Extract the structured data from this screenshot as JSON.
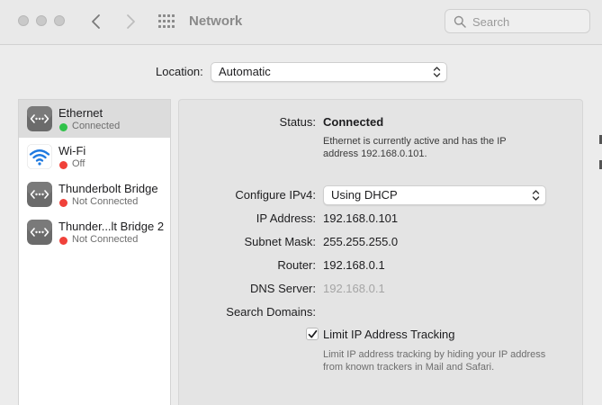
{
  "window": {
    "title": "Network"
  },
  "search": {
    "placeholder": "Search"
  },
  "location": {
    "label": "Location:",
    "value": "Automatic"
  },
  "sidebar": {
    "items": [
      {
        "name": "Ethernet",
        "status": "Connected",
        "status_color": "#30c24a",
        "icon": "ethernet-icon",
        "selected": true
      },
      {
        "name": "Wi-Fi",
        "status": "Off",
        "status_color": "#f0413a",
        "icon": "wifi-icon",
        "selected": false
      },
      {
        "name": "Thunderbolt Bridge",
        "status": "Not Connected",
        "status_color": "#f0413a",
        "icon": "thunderbolt-bridge-icon",
        "selected": false
      },
      {
        "name": "Thunder...lt Bridge 2",
        "status": "Not Connected",
        "status_color": "#f0413a",
        "icon": "thunderbolt-bridge-icon",
        "selected": false
      }
    ]
  },
  "detail": {
    "status_label": "Status:",
    "status_value": "Connected",
    "status_desc_line1": "Ethernet is currently active and has the IP",
    "status_desc_line2": "address 192.168.0.101.",
    "configure_label": "Configure IPv4:",
    "configure_value": "Using DHCP",
    "ip_label": "IP Address:",
    "ip_value": "192.168.0.101",
    "subnet_label": "Subnet Mask:",
    "subnet_value": "255.255.255.0",
    "router_label": "Router:",
    "router_value": "192.168.0.1",
    "dns_label": "DNS Server:",
    "dns_value": "192.168.0.1",
    "search_domains_label": "Search Domains:",
    "limit_tracking_label": "Limit IP Address Tracking",
    "limit_tracking_checked": true,
    "limit_desc_line1": "Limit IP address tracking by hiding your IP address",
    "limit_desc_line2": "from known trackers in Mail and Safari."
  }
}
